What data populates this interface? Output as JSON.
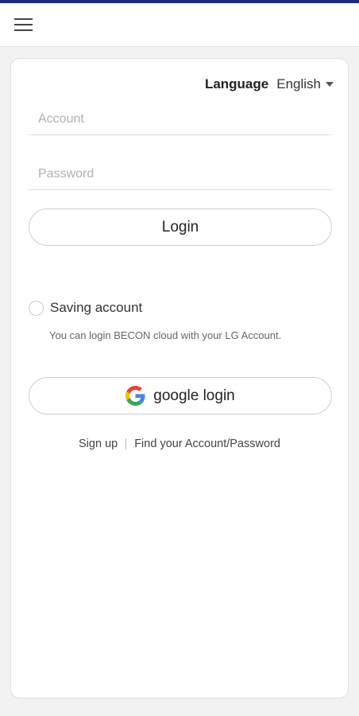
{
  "header": {
    "menu_icon": "hamburger-menu-icon"
  },
  "colors": {
    "top_bar": "#1a2b7a",
    "background": "#f2f2f2",
    "card": "#ffffff"
  },
  "language": {
    "label": "Language",
    "value": "English"
  },
  "form": {
    "account_placeholder": "Account",
    "password_placeholder": "Password",
    "login_label": "Login"
  },
  "saving": {
    "label": "Saving account",
    "checked": false
  },
  "hint": "You can login BECON cloud with your LG Account.",
  "google": {
    "label": "google login",
    "icon": "google-g-icon"
  },
  "links": {
    "signup": "Sign up",
    "find": "Find your Account/Password"
  }
}
